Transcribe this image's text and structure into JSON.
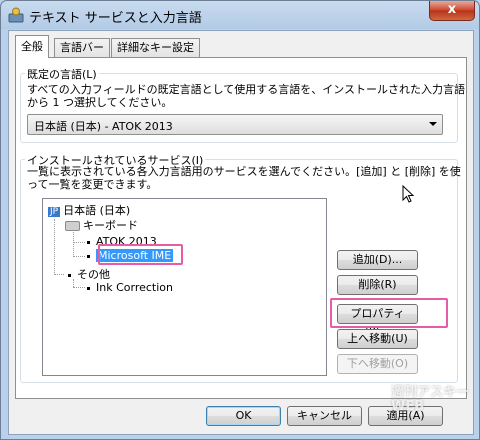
{
  "window": {
    "title": "テキスト サービスと入力言語",
    "close_label": "x"
  },
  "tabs": [
    {
      "label": "全般"
    },
    {
      "label": "言語バー"
    },
    {
      "label": "詳細なキー設定"
    }
  ],
  "default_language": {
    "group_label": "既定の言語(L)",
    "description_line1": "すべての入力フィールドの既定言語として使用する言語を、インストールされた入力言語",
    "description_line2": "から 1 つ選択してください。",
    "selected_value": "日本語 (日本) - ATOK 2013"
  },
  "installed_services": {
    "group_label": "インストールされているサービス(I)",
    "description_line1": "一覧に表示されている各入力言語用のサービスを選んでください。[追加] と [削除] を使",
    "description_line2": "って一覧を変更できます。",
    "tree": {
      "language_badge": "JP",
      "language": "日本語 (日本)",
      "keyboard_label": "キーボード",
      "keyboard_items": [
        "ATOK 2013",
        "Microsoft IME"
      ],
      "other_label": "その他",
      "other_items": [
        "Ink Correction"
      ]
    }
  },
  "buttons": {
    "add": "追加(D)...",
    "remove": "削除(R)",
    "properties": "プロパティ(P)...",
    "move_up": "上へ移動(U)",
    "move_down": "下へ移動(O)",
    "ok": "OK",
    "cancel": "キャンセル",
    "apply": "適用(A)"
  },
  "watermark": {
    "line1": "週刊アスキー",
    "line2": "WEB"
  },
  "colors": {
    "highlight": "#e65ca8",
    "selection": "#3399ff"
  }
}
